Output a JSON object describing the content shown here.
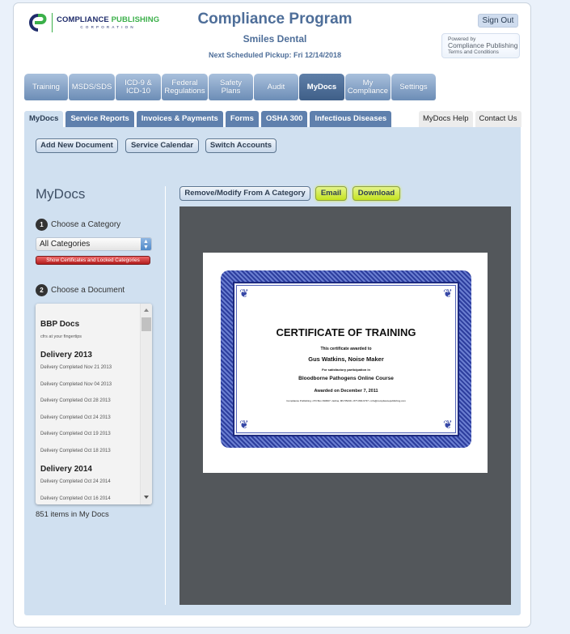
{
  "header": {
    "logo": {
      "line1a": "COMPLIANCE",
      "line1b": "PUBLISHING",
      "line2": "CORPORATION"
    },
    "title": "Compliance Program",
    "account": "Smiles Dental",
    "pickup": "Next Scheduled Pickup: Fri 12/14/2018",
    "sign_out": "Sign Out",
    "powered": {
      "line1": "Powered by",
      "line2": "Compliance Publishing",
      "line3": "Terms and Conditions"
    }
  },
  "main_nav": [
    {
      "label": "Training",
      "active": false
    },
    {
      "label": "MSDS/SDS",
      "active": false
    },
    {
      "label": "ICD-9 & ICD-10",
      "active": false
    },
    {
      "label": "Federal Regulations",
      "active": false
    },
    {
      "label": "Safety Plans",
      "active": false
    },
    {
      "label": "Audit",
      "active": false
    },
    {
      "label": "MyDocs",
      "active": true
    },
    {
      "label": "My Compliance",
      "active": false
    },
    {
      "label": "Settings",
      "active": false
    }
  ],
  "sub_tabs": [
    {
      "label": "MyDocs",
      "active": true
    },
    {
      "label": "Service Reports"
    },
    {
      "label": "Invoices & Payments"
    },
    {
      "label": "Forms"
    },
    {
      "label": "OSHA 300"
    },
    {
      "label": "Infectious Diseases"
    }
  ],
  "help_tabs": [
    "MyDocs Help",
    "Contact Us"
  ],
  "toolbar": {
    "add_new": "Add New Document",
    "calendar": "Service Calendar",
    "switch": "Switch Accounts"
  },
  "sidebar": {
    "heading": "MyDocs",
    "step1_num": "1",
    "step1": "Choose a Category",
    "category_selected": "All Categories",
    "show_locked": "Show Certificates and Locked Categories",
    "step2_num": "2",
    "step2": "Choose a Document",
    "groups": [
      {
        "title": "BBP Docs",
        "subtitle": "cfrs at your fingertips",
        "items": []
      },
      {
        "title": "Delivery 2013",
        "items": [
          "Delivery Completed Nov 21 2013",
          "Delivery Completed Nov 04 2013",
          "Delivery Completed Oct 28 2013",
          "Delivery Completed Oct 24 2013",
          "Delivery Completed Oct 19 2013",
          "Delivery Completed Oct 18 2013"
        ]
      },
      {
        "title": "Delivery 2014",
        "items": [
          "Delivery Completed Oct 24 2014",
          "Delivery Completed Oct 16 2014"
        ]
      }
    ],
    "count": "851 items in My Docs"
  },
  "doc_actions": {
    "remove": "Remove/Modify From A Category",
    "email": "Email",
    "download": "Download"
  },
  "certificate": {
    "title": "CERTIFICATE OF TRAINING",
    "awarded_to_label": "This certificate awarded to",
    "recipient": "Gus Watkins, Noise Maker",
    "participation_label": "For satisfactory participation in",
    "course": "Bloodborne Pathogens Online Course",
    "date": "Awarded on December 7, 2011",
    "footer": "Compliance Publishing • PO Box 390607 • Edina, MN 55439 • 877-800-6737 • info@compliancepublishing.com"
  },
  "colors": {
    "accent": "#4e6e99",
    "nav_active": "#3f5f88",
    "panel": "#d0e0f0",
    "highlight": "#c4e21f",
    "danger": "#b21d1d",
    "viewer_bg": "#53575b"
  }
}
